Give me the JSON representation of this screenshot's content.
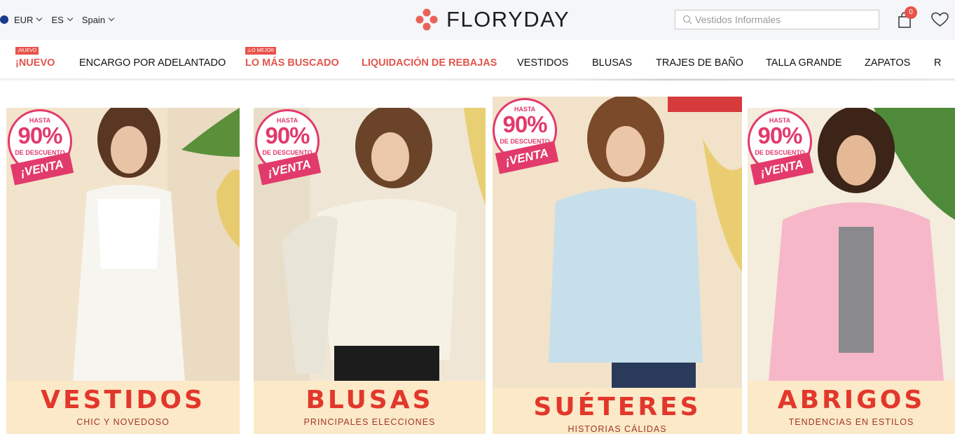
{
  "topbar": {
    "currency": "EUR",
    "language": "ES",
    "country": "Spain",
    "logo_text": "FLORYDAY",
    "search_placeholder": "Vestidos Informales",
    "cart_count": "0"
  },
  "nav": {
    "items": [
      {
        "label": "¡NUEVO",
        "tag": "¡NUEVO",
        "hot": true
      },
      {
        "label": "ENCARGO POR ADELANTADO"
      },
      {
        "label": "LO MÁS BUSCADO",
        "tag": "¡LO MEJOR",
        "hot": true
      },
      {
        "label": "LIQUIDACIÓN DE REBAJAS",
        "hot": true
      },
      {
        "label": "VESTIDOS"
      },
      {
        "label": "BLUSAS"
      },
      {
        "label": "TRAJES DE BAÑO"
      },
      {
        "label": "TALLA GRANDE"
      },
      {
        "label": "ZAPATOS"
      },
      {
        "label": "R"
      }
    ]
  },
  "promo_badge": {
    "hasta": "HASTA",
    "percent": "90%",
    "off": "DE DESCUENTO",
    "ribbon": "¡VENTA"
  },
  "cards": [
    {
      "title": "VESTIDOS",
      "subtitle": "CHIC Y NOVEDOSO",
      "garment_color": "#f7f5f0",
      "bg": "#f3e4cc"
    },
    {
      "title": "BLUSAS",
      "subtitle": "PRINCIPALES ELECCIONES",
      "garment_color": "#f5f1e4",
      "bg": "#efe6d6"
    },
    {
      "title": "SUÉTERES",
      "subtitle": "HISTORIAS CÁLIDAS",
      "garment_color": "#c7dfea",
      "bg": "#f1e2c9"
    },
    {
      "title": "ABRIGOS",
      "subtitle": "TENDENCIAS EN ESTILOS",
      "garment_color": "#f6b8c8",
      "bg": "#f4ecdc"
    }
  ],
  "colors": {
    "accent": "#e2564e",
    "badge_pink": "#e23a6b",
    "caption_bg": "#fbe9c8",
    "caption_title": "#e2372b"
  }
}
